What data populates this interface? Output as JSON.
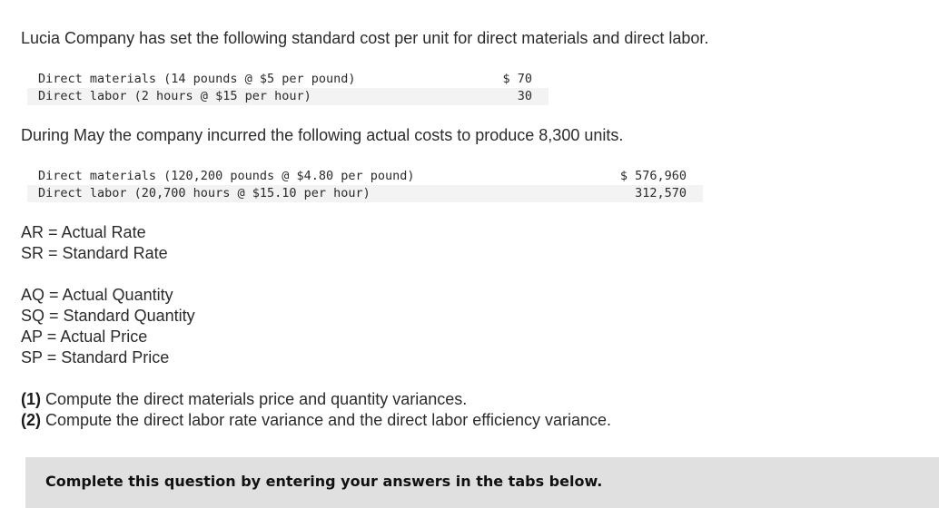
{
  "intro_text": "Lucia Company has set the following standard cost per unit for direct materials and direct labor.",
  "standard_costs": [
    {
      "description": "Direct materials (14 pounds @ $5 per pound)",
      "amount": "$ 70"
    },
    {
      "description": "Direct labor (2 hours @ $15 per hour)",
      "amount": "30"
    }
  ],
  "actual_intro_text": "During May the company incurred the following actual costs to produce 8,300 units.",
  "actual_costs": [
    {
      "description": "Direct materials (120,200 pounds @ $4.80 per pound)",
      "amount": "$ 576,960"
    },
    {
      "description": "Direct labor (20,700 hours @ $15.10 per hour)",
      "amount": "312,570"
    }
  ],
  "rate_definitions": [
    "AR = Actual Rate",
    "SR = Standard Rate"
  ],
  "quantity_price_definitions": [
    "AQ = Actual Quantity",
    "SQ = Standard Quantity",
    "AP = Actual Price",
    "SP = Standard Price"
  ],
  "requirements": [
    {
      "number": "(1)",
      "text": " Compute the direct materials price and quantity variances."
    },
    {
      "number": "(2)",
      "text": " Compute the direct labor rate variance and the direct labor efficiency variance."
    }
  ],
  "instruction_text": "Complete this question by entering your answers in the tabs below."
}
